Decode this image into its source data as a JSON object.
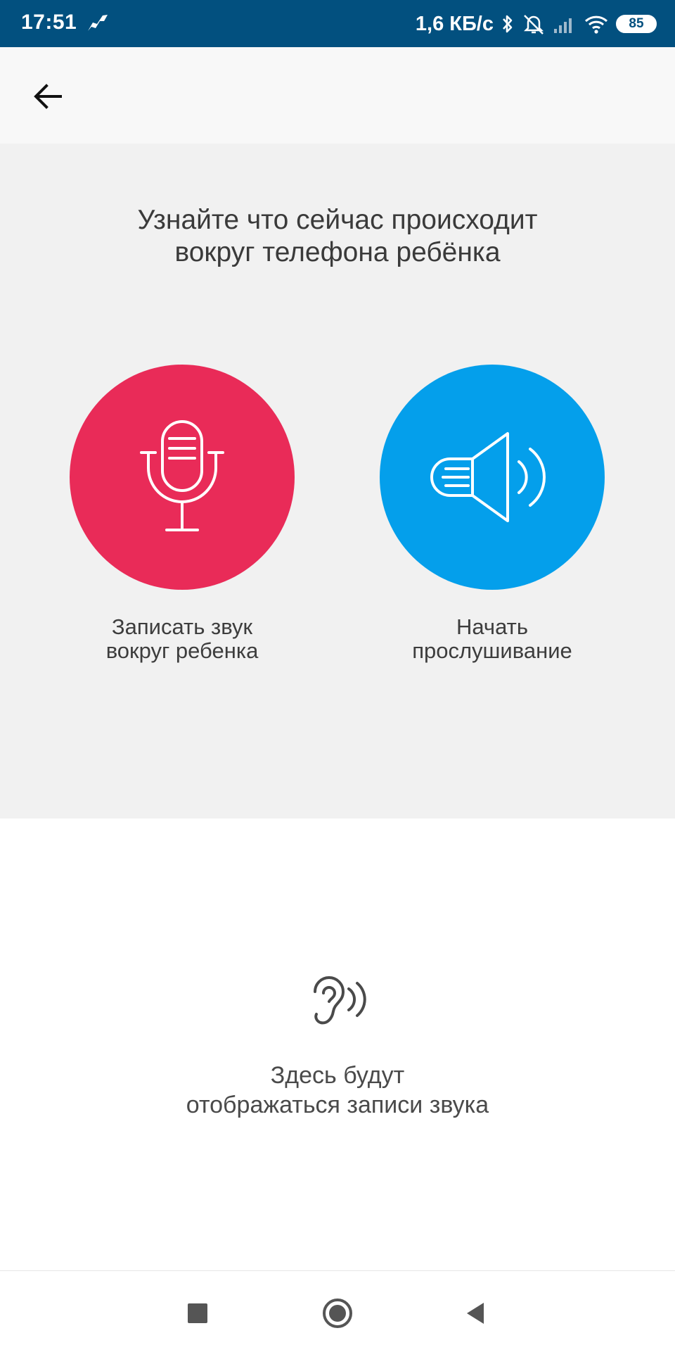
{
  "status_bar": {
    "time": "17:51",
    "network_speed": "1,6 КБ/с",
    "battery_level": "85",
    "icons": [
      "notification-icon",
      "bluetooth-icon",
      "silent-icon",
      "signal-icon",
      "wifi-icon",
      "battery-icon"
    ]
  },
  "app_bar": {
    "back_icon": "arrow-left-icon"
  },
  "hero": {
    "title": "Узнайте что сейчас происходит\nвокруг телефона ребёнка",
    "actions": [
      {
        "label": "Записать звук\nвокруг ребенка",
        "icon": "microphone-icon",
        "color": "#e92b58"
      },
      {
        "label": "Начать\nпрослушивание",
        "icon": "speaker-icon",
        "color": "#049feb"
      }
    ]
  },
  "empty_state": {
    "icon": "ear-icon",
    "text": "Здесь будут\nотображаться записи звука"
  },
  "nav_bar": {
    "buttons": [
      "recent-apps-icon",
      "home-icon",
      "back-icon"
    ]
  },
  "colors": {
    "status_bar": "#02507f",
    "app_bar": "#f8f8f8",
    "hero_background": "#f1f1f1"
  }
}
